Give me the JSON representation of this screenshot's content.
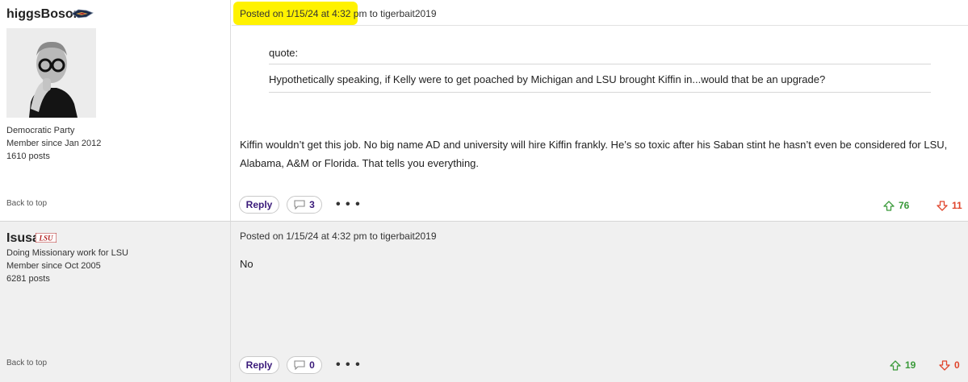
{
  "posts": [
    {
      "username": "higgsBoson",
      "badge_icon": "pelicans-logo-icon",
      "avatar_icon": "user-photo-avatar",
      "meta": [
        "Democratic Party",
        "Member since Jan 2012",
        "1610 posts"
      ],
      "back_to_top": "Back to top",
      "posted": "Posted on 1/15/24 at 4:32 pm",
      "to": " to tigerbait2019",
      "highlighted": true,
      "quote_label": "quote:",
      "quote_text": "Hypothetically speaking, if Kelly were to get poached by Michigan and LSU brought Kiffin in...would that be an upgrade?",
      "body": "Kiffin wouldn’t get this job. No big name AD and university will hire Kiffin frankly. He’s so toxic after his Saban stint he hasn’t even be considered for LSU, Alabama, A&M or Florida. That tells you everything.",
      "reply_label": "Reply",
      "comment_count": "3",
      "more_label": "• • •",
      "upvotes": "76",
      "downvotes": "11"
    },
    {
      "username": "Isusa",
      "badge_icon": "lsu-logo-icon",
      "meta": [
        "Doing Missionary work for LSU",
        "Member since Oct 2005",
        "6281 posts"
      ],
      "back_to_top": "Back to top",
      "posted": "Posted on 1/15/24 at 4:32 pm",
      "to": " to tigerbait2019",
      "body": "No",
      "reply_label": "Reply",
      "comment_count": "0",
      "more_label": "• • •",
      "upvotes": "19",
      "downvotes": "0"
    }
  ],
  "colors": {
    "highlight": "#fff200",
    "upvote": "#3a9a3a",
    "downvote": "#e0452c",
    "button_text": "#3a1a7a",
    "alt_row_bg": "#f0f0f0"
  }
}
